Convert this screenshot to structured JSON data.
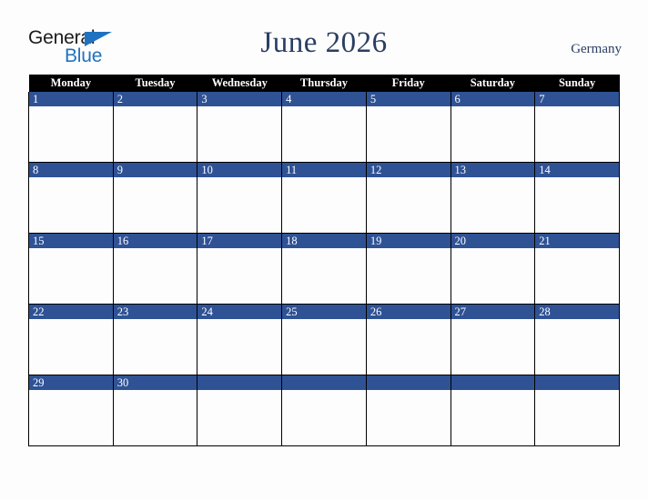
{
  "brand": {
    "name_top": "General",
    "name_bottom": "Blue",
    "triangle_color": "#1f72c1",
    "top_text_color": "#1b1b1b"
  },
  "header": {
    "title": "June 2026",
    "country": "Germany",
    "title_color": "#2b3e63"
  },
  "calendar": {
    "weekday_headers": [
      "Monday",
      "Tuesday",
      "Wednesday",
      "Thursday",
      "Friday",
      "Saturday",
      "Sunday"
    ],
    "header_background": "#000000",
    "header_text_color": "#ffffff",
    "date_band_color": "#2f5295",
    "date_text_color": "#ffffff",
    "cell_background": "#fdfdfd",
    "grid_line_color": "#000000",
    "weeks": [
      {
        "days": [
          "1",
          "2",
          "3",
          "4",
          "5",
          "6",
          "7"
        ]
      },
      {
        "days": [
          "8",
          "9",
          "10",
          "11",
          "12",
          "13",
          "14"
        ]
      },
      {
        "days": [
          "15",
          "16",
          "17",
          "18",
          "19",
          "20",
          "21"
        ]
      },
      {
        "days": [
          "22",
          "23",
          "24",
          "25",
          "26",
          "27",
          "28"
        ]
      },
      {
        "days": [
          "29",
          "30",
          "",
          "",
          "",
          "",
          ""
        ]
      }
    ]
  },
  "page": {
    "background": "#fdfdfd"
  }
}
